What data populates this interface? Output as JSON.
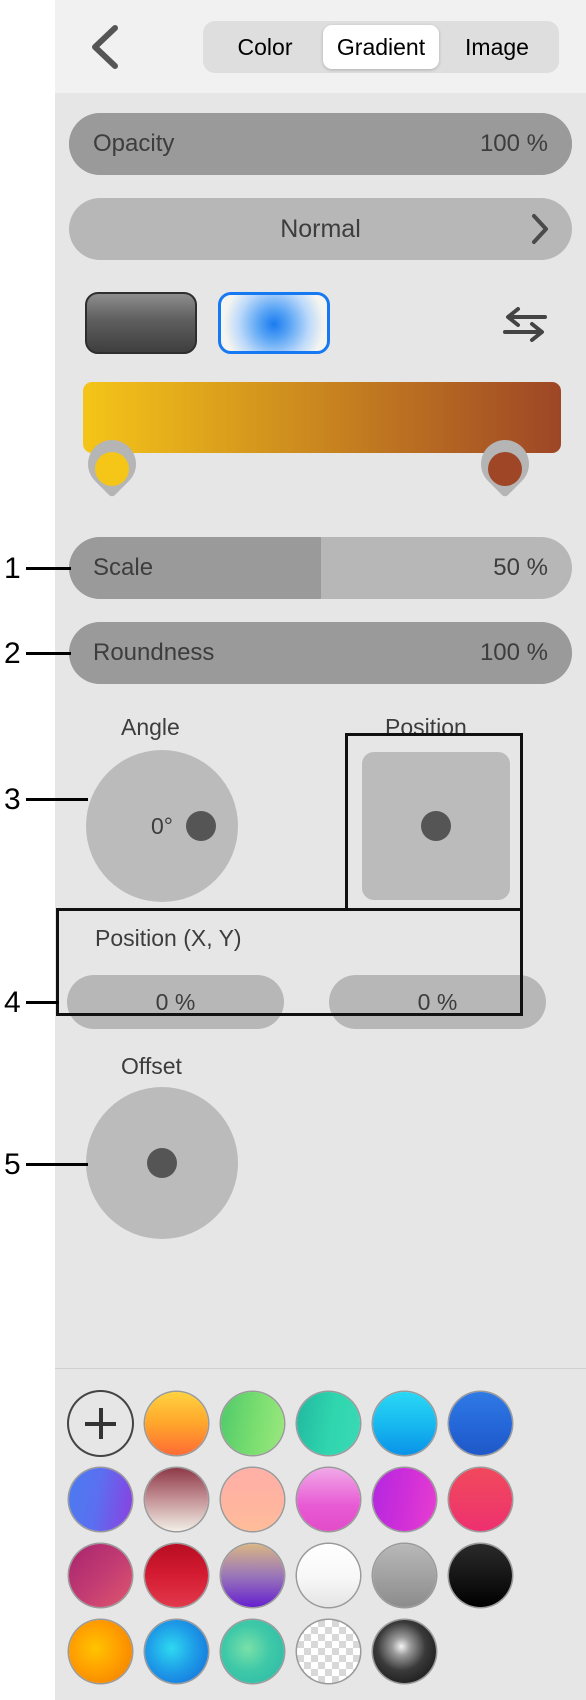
{
  "header": {
    "back_icon": "chevron-left-icon",
    "tabs": [
      {
        "label": "Color",
        "active": false
      },
      {
        "label": "Gradient",
        "active": true
      },
      {
        "label": "Image",
        "active": false
      }
    ]
  },
  "controls": {
    "opacity": {
      "label": "Opacity",
      "value": "100 %",
      "fill_percent": 100
    },
    "blend_mode": {
      "value": "Normal",
      "chevron_icon": "chevron-right-icon"
    },
    "gradient_types": [
      {
        "name": "linear-gradient-swatch",
        "selected": false
      },
      {
        "name": "radial-gradient-swatch",
        "selected": true
      }
    ],
    "swap_icon": "swap-arrows-icon",
    "gradient_bar": {
      "start_color": "#f5c518",
      "end_color": "#9e4626",
      "stops": [
        {
          "color": "#f5c518",
          "position_percent": 0
        },
        {
          "color": "#9e4626",
          "position_percent": 100
        }
      ]
    },
    "scale": {
      "label": "Scale",
      "value": "50 %",
      "fill_percent": 50
    },
    "roundness": {
      "label": "Roundness",
      "value": "100 %",
      "fill_percent": 100
    },
    "angle": {
      "label": "Angle",
      "value": "0°"
    },
    "position": {
      "label": "Position"
    },
    "position_xy": {
      "label": "Position (X, Y)",
      "x_value": "0 %",
      "y_value": "0 %"
    },
    "offset": {
      "label": "Offset"
    }
  },
  "callouts": [
    {
      "number": "1"
    },
    {
      "number": "2"
    },
    {
      "number": "3"
    },
    {
      "number": "4"
    },
    {
      "number": "5"
    }
  ],
  "palette": {
    "add_label": "+",
    "rows": [
      [
        {
          "name": "add-swatch",
          "kind": "plus"
        },
        {
          "name": "swatch-orange-yellow",
          "css": "linear-gradient(180deg,#ffd23f 0%,#ffa62b 50%,#ff6b35 100%)"
        },
        {
          "name": "swatch-green",
          "css": "linear-gradient(100deg,#4fc96a 0%,#7ade70 55%,#9ce87f 100%)"
        },
        {
          "name": "swatch-teal",
          "css": "linear-gradient(100deg,#22b8a0 0%,#2fd6ae 55%,#3ad9b5 100%)"
        },
        {
          "name": "swatch-cyan",
          "css": "linear-gradient(180deg,#2ad8f5 0%,#16b6ef 55%,#0a92e8 100%)"
        },
        {
          "name": "swatch-blue",
          "css": "linear-gradient(180deg,#2f7ae5 0%,#2566d8 55%,#1f58c8 100%)"
        }
      ],
      [
        {
          "name": "swatch-blue-purple",
          "css": "linear-gradient(100deg,#4a7cf0 0%,#5b6ff0 45%,#8c3fe0 100%)"
        },
        {
          "name": "swatch-maroon-white",
          "css": "linear-gradient(180deg,#8e3a48 0%,#c08a90 45%,#e8dcd6 90%,#f4efe9 100%)"
        },
        {
          "name": "swatch-peach",
          "css": "linear-gradient(180deg,#ffb0a8 0%,#ffb49f 55%,#ffbd9a 100%)"
        },
        {
          "name": "swatch-pink-magenta",
          "css": "linear-gradient(180deg,#f0a8e8 0%,#e85ad4 60%,#e24cc8 100%)"
        },
        {
          "name": "swatch-purple-magenta",
          "css": "linear-gradient(100deg,#b327e0 0%,#d12fd8 55%,#e83fd0 100%)"
        },
        {
          "name": "swatch-red-pink",
          "css": "linear-gradient(180deg,#f0485c 0%,#ef3d66 55%,#ee2f70 100%)"
        }
      ],
      [
        {
          "name": "swatch-magenta-rose",
          "css": "linear-gradient(135deg,#a8256e 0%,#c13a72 50%,#e0566e 100%)"
        },
        {
          "name": "swatch-crimson",
          "css": "linear-gradient(180deg,#b80d22 0%,#d41c32 50%,#e2394c 100%)"
        },
        {
          "name": "swatch-tan-purple",
          "css": "linear-gradient(180deg,#d9b585 0%,#9a77b8 50%,#6620cf 100%)"
        },
        {
          "name": "swatch-white",
          "css": "linear-gradient(180deg,#ffffff 0%,#f7f7f7 55%,#e4e4e4 100%)"
        },
        {
          "name": "swatch-gray",
          "css": "linear-gradient(180deg,#b8b8b8 0%,#a0a0a0 55%,#8c8c8c 100%)"
        },
        {
          "name": "swatch-black",
          "css": "linear-gradient(180deg,#2a2a2a 0%,#141414 55%,#000000 100%)"
        }
      ],
      [
        {
          "name": "swatch-radial-orange",
          "css": "radial-gradient(circle at 42% 45%,#ffc400 0%,#ffa000 45%,#f07800 100%)"
        },
        {
          "name": "swatch-radial-blue",
          "css": "radial-gradient(circle at 42% 45%,#2ed9f0 0%,#1e9ee8 45%,#1565d8 100%)"
        },
        {
          "name": "swatch-radial-teal",
          "css": "radial-gradient(circle at 42% 45%,#7ae0a8 0%,#3fc9a8 45%,#2ab8a8 100%)"
        },
        {
          "name": "swatch-transparent-checker",
          "kind": "checker"
        },
        {
          "name": "swatch-radial-black-white",
          "css": "radial-gradient(circle at 45% 42%,#f5f5f5 0%,#9a9a9a 18%,#3a3a3a 48%,#0a0a0a 100%)"
        }
      ]
    ]
  }
}
